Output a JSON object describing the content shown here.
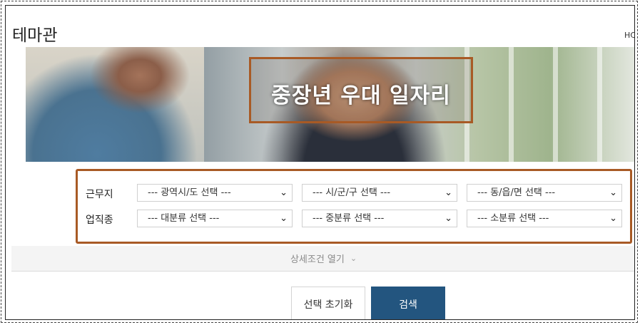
{
  "page": {
    "title": "테마관",
    "nav_partial": "HC"
  },
  "banner": {
    "title": "중장년 우대 일자리"
  },
  "search": {
    "rows": [
      {
        "label": "근무지",
        "selects": [
          {
            "value": "--- 광역시/도 선택 ---"
          },
          {
            "value": "--- 시/군/구 선택 ---"
          },
          {
            "value": "--- 동/읍/면 선택 ---"
          }
        ]
      },
      {
        "label": "업직종",
        "selects": [
          {
            "value": "--- 대분류 선택 ---"
          },
          {
            "value": "--- 중분류 선택 ---"
          },
          {
            "value": "--- 소분류 선택 ---"
          }
        ]
      }
    ]
  },
  "detail_toggle": {
    "label": "상세조건 열기",
    "icon": "chevron-down-icon"
  },
  "actions": {
    "reset_label": "선택 초기화",
    "search_label": "검색"
  },
  "colors": {
    "highlight_border": "#a85a25",
    "search_button": "#23557f"
  }
}
